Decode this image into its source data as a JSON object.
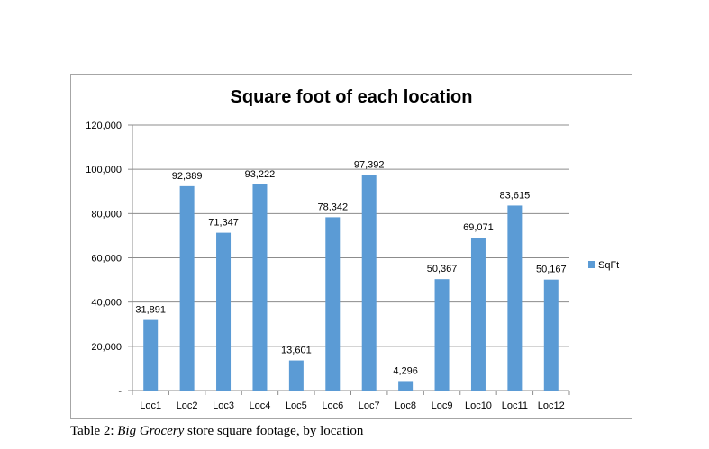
{
  "chart_data": {
    "type": "bar",
    "title": "Square foot of each location",
    "categories": [
      "Loc1",
      "Loc2",
      "Loc3",
      "Loc4",
      "Loc5",
      "Loc6",
      "Loc7",
      "Loc8",
      "Loc9",
      "Loc10",
      "Loc11",
      "Loc12"
    ],
    "series": [
      {
        "name": "SqFt",
        "values": [
          31891,
          92389,
          71347,
          93222,
          13601,
          78342,
          97392,
          4296,
          50367,
          69071,
          83615,
          50167
        ]
      }
    ],
    "value_labels": [
      "31,891",
      "92,389",
      "71,347",
      "93,222",
      "13,601",
      "78,342",
      "97,392",
      "4,296",
      "50,367",
      "69,071",
      "83,615",
      "50,167"
    ],
    "yticks": [
      "-",
      "20,000",
      "40,000",
      "60,000",
      "80,000",
      "100,000",
      "120,000"
    ],
    "ylim": [
      0,
      120000
    ],
    "grid": true,
    "legend_position": "right",
    "bar_color": "#5b9bd5"
  },
  "caption": {
    "prefix": "Table 2: ",
    "italic": "Big Grocery",
    "suffix": " store square footage, by location"
  }
}
